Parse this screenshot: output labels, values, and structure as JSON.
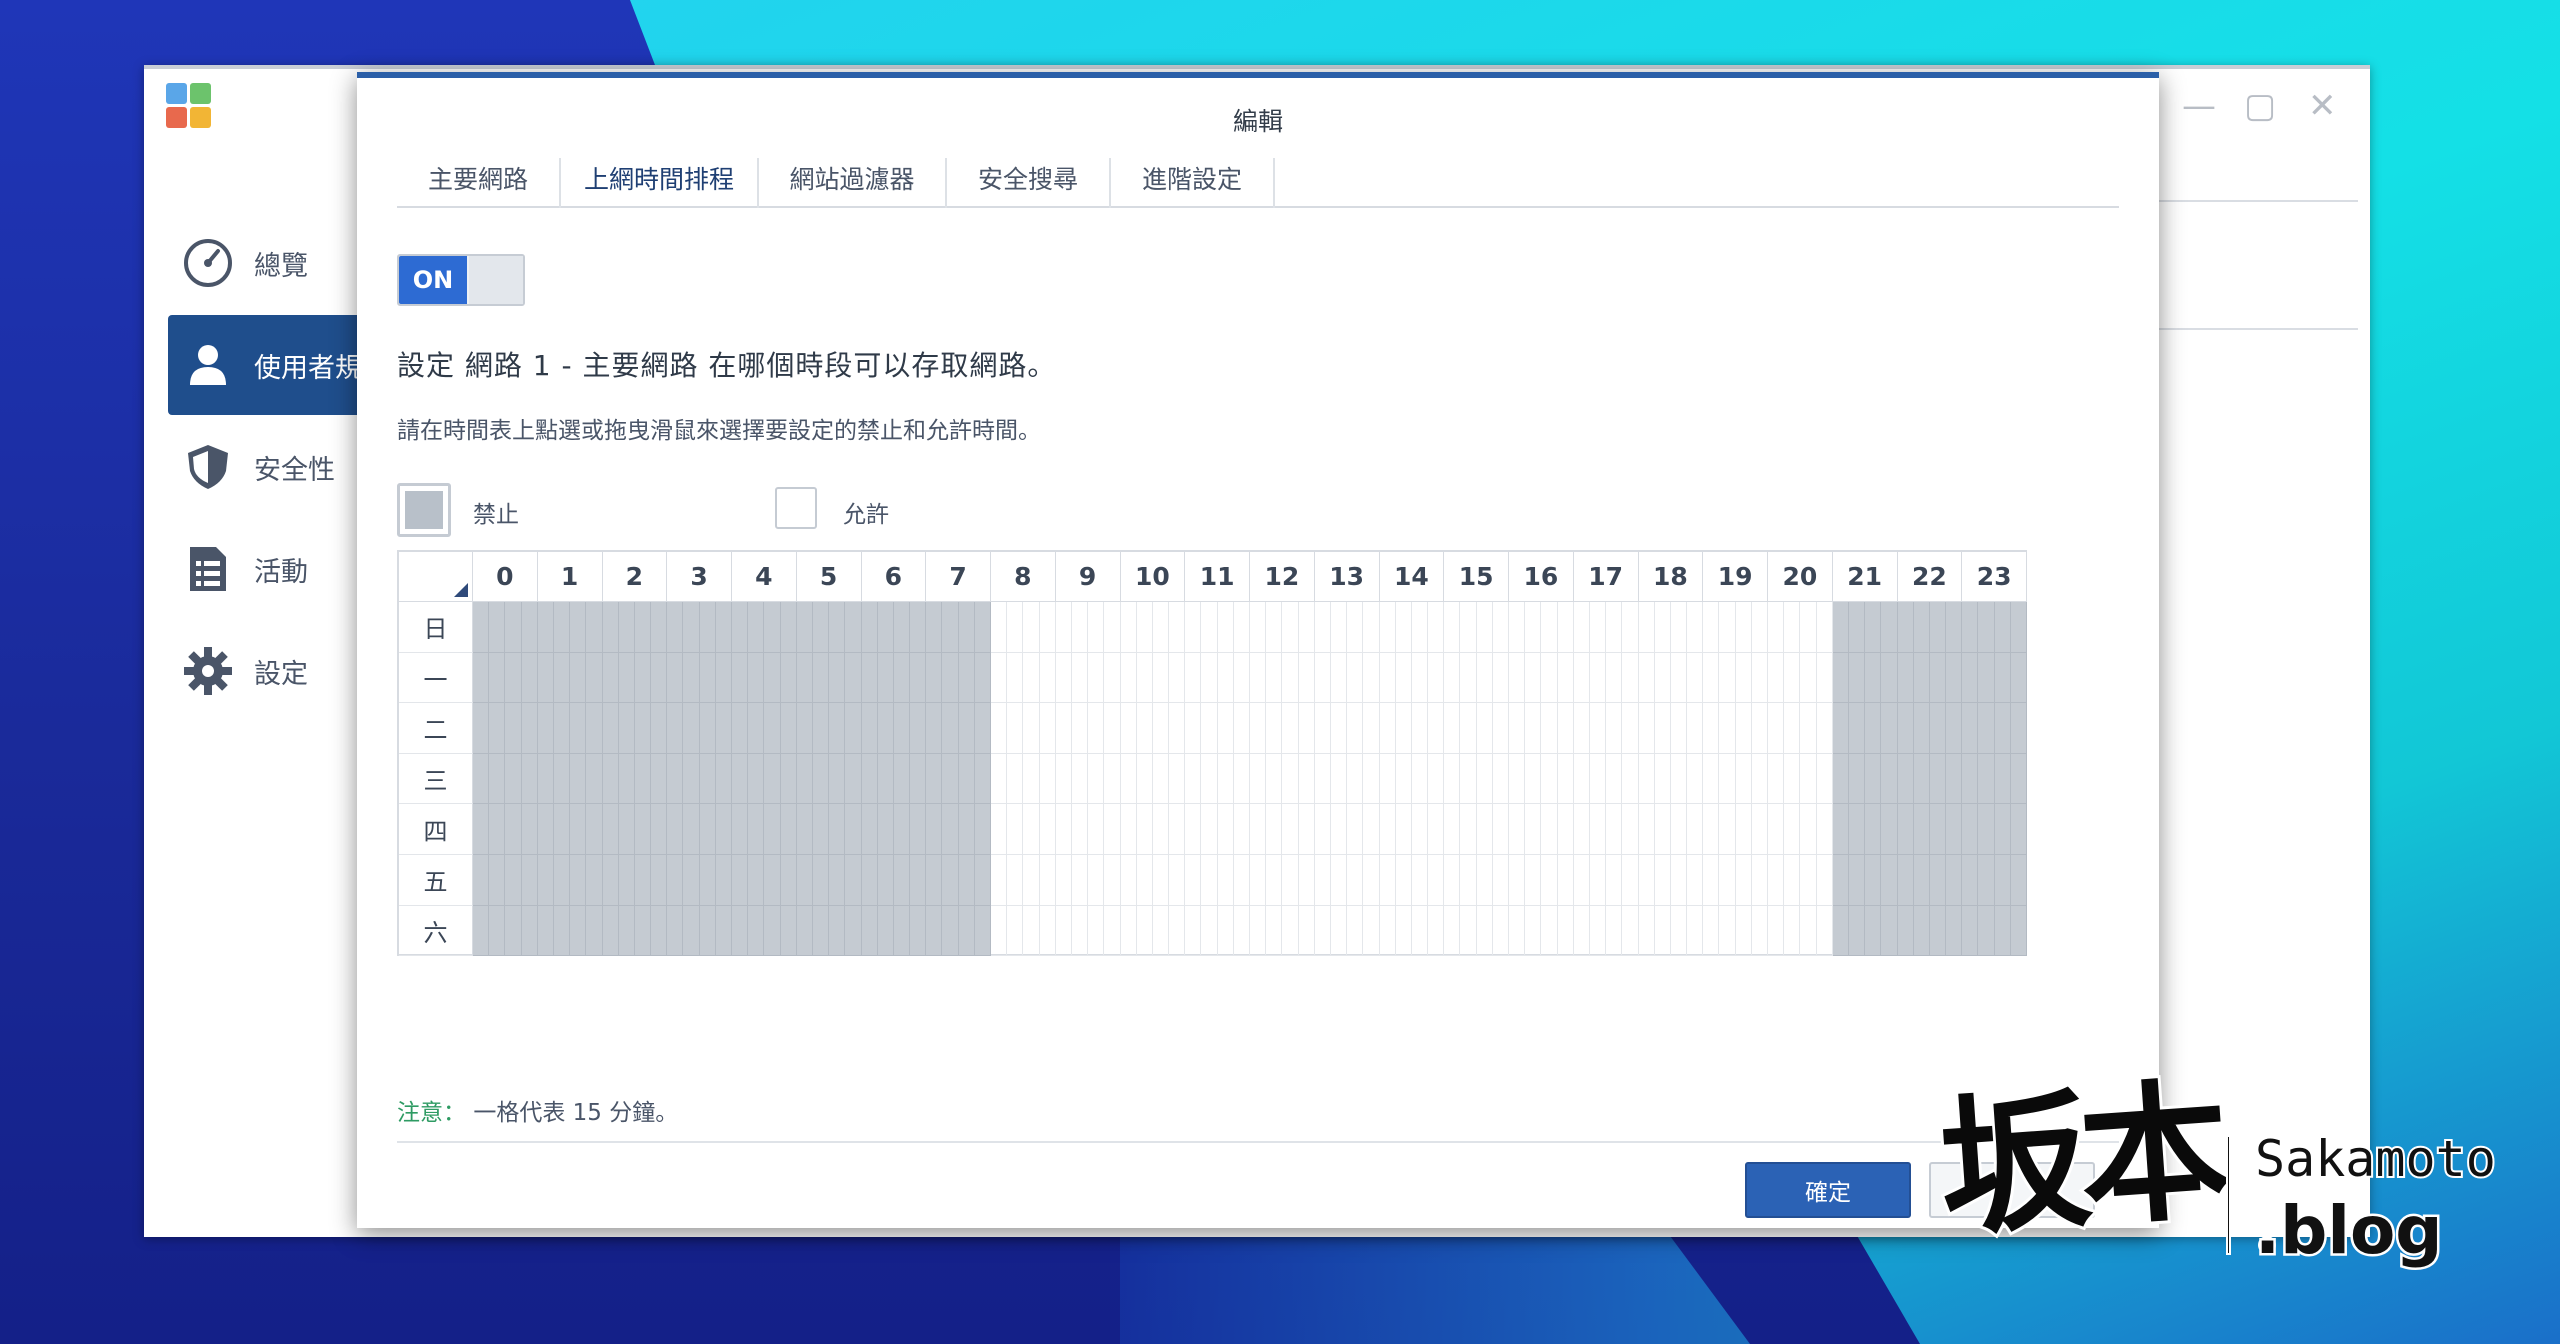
{
  "sidebar": {
    "items": [
      {
        "label": "總覽",
        "icon": "speedometer-icon"
      },
      {
        "label": "使用者規",
        "icon": "user-icon"
      },
      {
        "label": "安全性",
        "icon": "shield-icon"
      },
      {
        "label": "活動",
        "icon": "list-icon"
      },
      {
        "label": "設定",
        "icon": "gear-icon"
      }
    ],
    "active_index": 1
  },
  "dialog": {
    "title": "編輯",
    "tabs": [
      "主要網路",
      "上網時間排程",
      "網站過濾器",
      "安全搜尋",
      "進階設定"
    ],
    "active_tab": 1,
    "toggle_label": "ON",
    "heading": "設定 網路 1 - 主要網路 在哪個時段可以存取網路。",
    "instruction": "請在時間表上點選或拖曳滑鼠來選擇要設定的禁止和允許時間。",
    "legend": {
      "deny": "禁止",
      "allow": "允許"
    },
    "note_label": "注意：",
    "note_text": "一格代表 15 分鐘。",
    "confirm_label": "確定"
  },
  "schedule": {
    "hours": [
      "0",
      "1",
      "2",
      "3",
      "4",
      "5",
      "6",
      "7",
      "8",
      "9",
      "10",
      "11",
      "12",
      "13",
      "14",
      "15",
      "16",
      "17",
      "18",
      "19",
      "20",
      "21",
      "22",
      "23"
    ],
    "days": [
      "日",
      "一",
      "二",
      "三",
      "四",
      "五",
      "六"
    ],
    "cells_per_hour": 4,
    "deny_hours": [
      0,
      1,
      2,
      3,
      4,
      5,
      6,
      7,
      21,
      22,
      23
    ]
  },
  "watermark": {
    "cjk": "坂本",
    "latin": "Sakamoto",
    "blog": "blog"
  },
  "colors": {
    "accent": "#2b5fa8",
    "deny_cell": "#c5cbd2",
    "toggle_on": "#2d6bd3",
    "note_label": "#2e9b63"
  }
}
